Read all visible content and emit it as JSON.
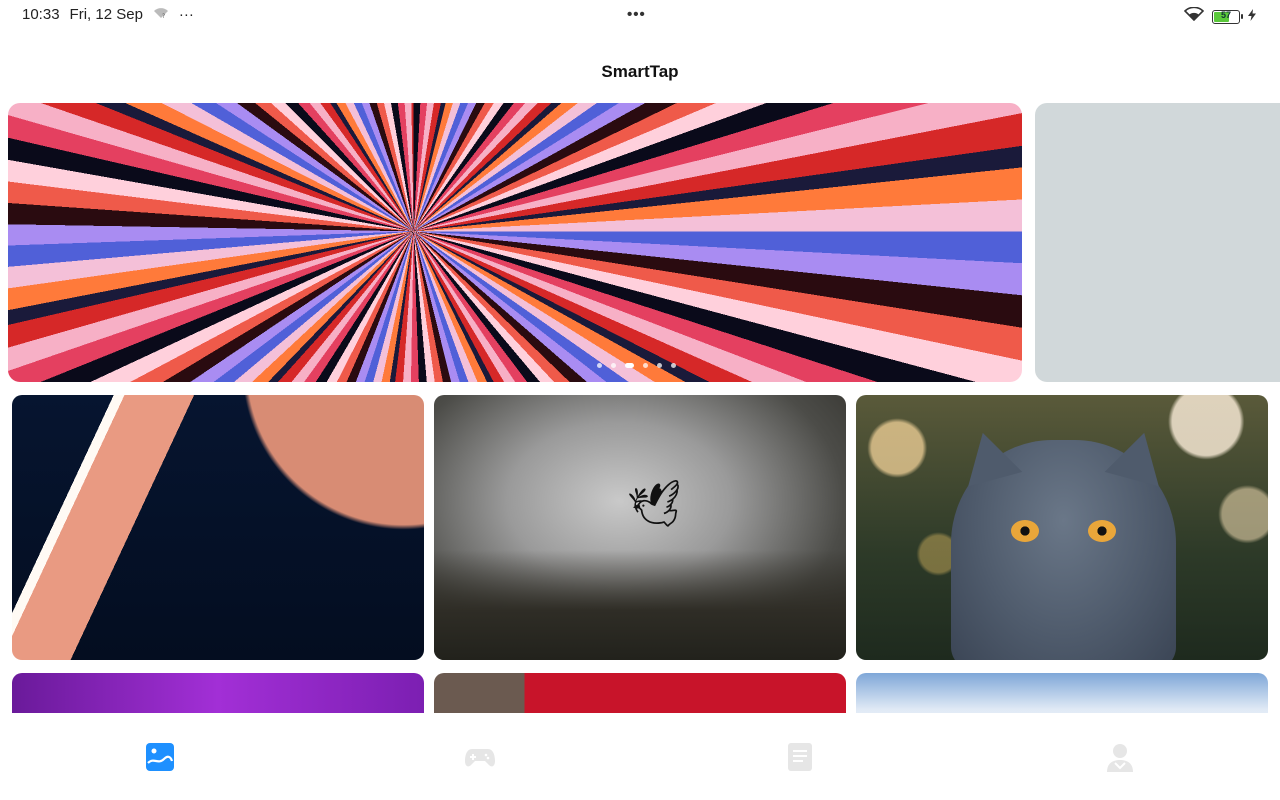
{
  "status_bar": {
    "time": "10:33",
    "date": "Fri, 12 Sep",
    "more_indicator": "···",
    "center_indicator": "•••",
    "battery_level": "57",
    "icons": [
      "wifi-question-icon",
      "wifi-icon",
      "battery-icon",
      "charging-icon"
    ]
  },
  "app": {
    "title": "SmartTap"
  },
  "banner": {
    "dot_count": 6,
    "active_dot_index": 2
  },
  "wallpapers": [
    {
      "name": "abstract-orange-stripe"
    },
    {
      "name": "bird-in-fog"
    },
    {
      "name": "grey-cat-bokeh"
    },
    {
      "name": "purple-forest"
    },
    {
      "name": "red-tree"
    },
    {
      "name": "blue-sky-clouds"
    }
  ],
  "bottom_nav": {
    "items": [
      {
        "icon": "wallpaper-icon",
        "active": true
      },
      {
        "icon": "gamepad-icon",
        "active": false
      },
      {
        "icon": "document-icon",
        "active": false
      },
      {
        "icon": "profile-icon",
        "active": false
      }
    ],
    "active_color": "#1e90ff",
    "inactive_color": "#e6e6e6"
  }
}
